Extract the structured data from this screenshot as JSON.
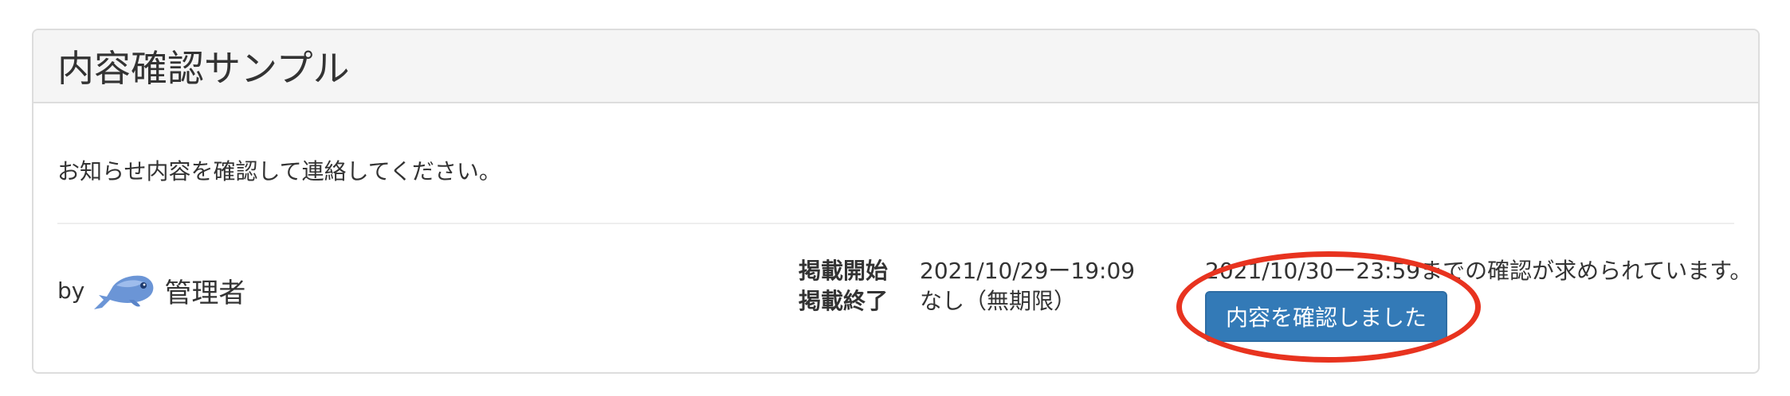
{
  "panel": {
    "title": "内容確認サンプル",
    "message": "お知らせ内容を確認して連絡してください。"
  },
  "author": {
    "by_label": "by",
    "name": "管理者",
    "avatar_icon": "fish-icon"
  },
  "period": {
    "start_label": "掲載開始",
    "start_value": "2021/10/29ー19:09",
    "end_label": "掲載終了",
    "end_value": "なし（無期限）"
  },
  "confirmation": {
    "deadline_text": "2021/10/30ー23:59までの確認が求められています。",
    "button_label": "内容を確認しました"
  },
  "colors": {
    "button": "#337ab7",
    "highlight": "#e8331f",
    "heading_bg": "#f5f5f5"
  }
}
